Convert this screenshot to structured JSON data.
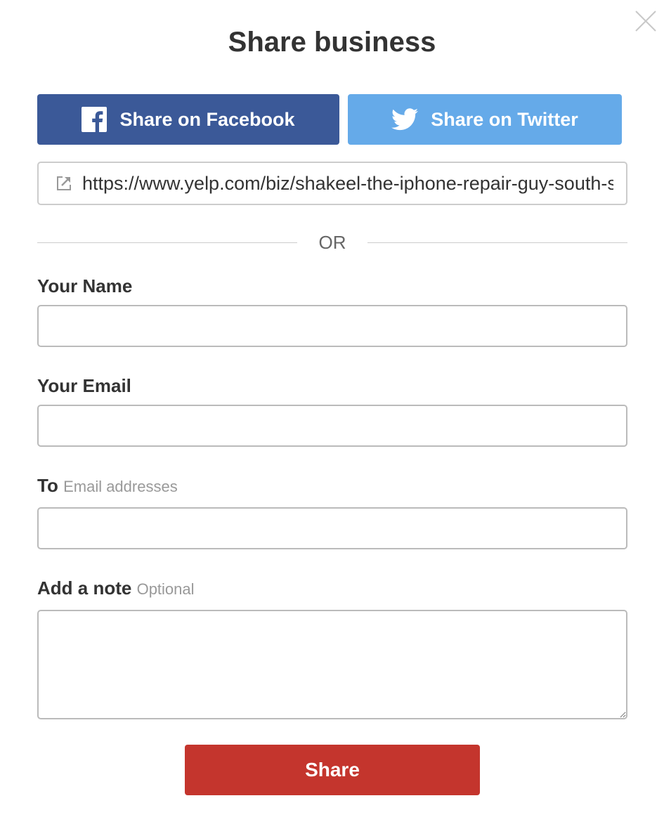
{
  "modal": {
    "title": "Share business",
    "close_icon": "close-icon"
  },
  "social": {
    "facebook_label": "Share on Facebook",
    "facebook_icon": "facebook-icon",
    "facebook_color": "#3b5998",
    "twitter_label": "Share on Twitter",
    "twitter_icon": "twitter-icon",
    "twitter_color": "#65aae9"
  },
  "link": {
    "icon": "external-link-icon",
    "url": "https://www.yelp.com/biz/shakeel-the-iphone-repair-guy-south-san-francisco"
  },
  "divider": {
    "text": "OR"
  },
  "form": {
    "name_label": "Your Name",
    "name_value": "",
    "email_label": "Your Email",
    "email_value": "",
    "to_label": "To",
    "to_hint": "Email addresses",
    "to_value": "",
    "note_label": "Add a note",
    "note_hint": "Optional",
    "note_value": ""
  },
  "actions": {
    "share_label": "Share",
    "share_color": "#c4352d"
  }
}
